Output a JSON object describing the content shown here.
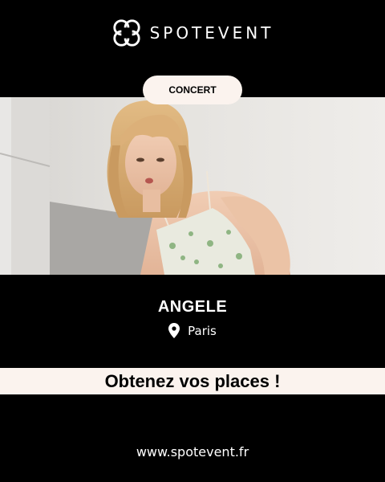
{
  "brand": {
    "name": "SPOTEVENT",
    "logo_icon": "quatrefoil-logo-icon"
  },
  "event": {
    "category": "CONCERT",
    "artist": "ANGELE",
    "city": "Paris",
    "location_icon": "map-pin-icon",
    "photo": "artist-portrait-photo"
  },
  "cta": {
    "label": "Obtenez vos places !"
  },
  "footer": {
    "url": "www.spotevent.fr"
  },
  "colors": {
    "background": "#000000",
    "cream": "#fbf3ee",
    "text_light": "#ffffff",
    "text_dark": "#000000"
  }
}
